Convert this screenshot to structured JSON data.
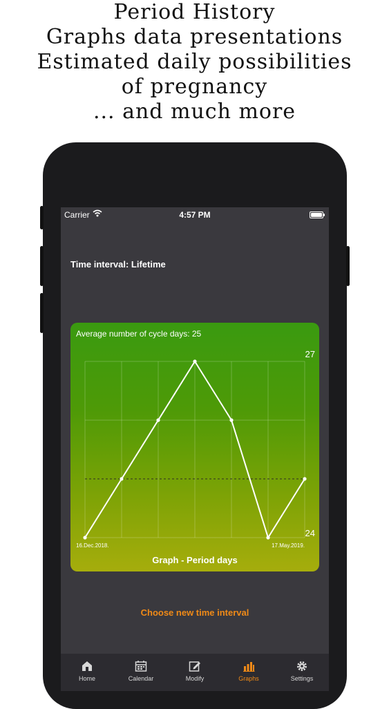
{
  "promo": {
    "lines": [
      "Period History",
      "Graphs data presentations",
      "Estimated daily possibilities",
      "of pregnancy",
      "... and much more"
    ]
  },
  "status_bar": {
    "carrier": "Carrier",
    "time": "4:57 PM"
  },
  "time_interval": "Time interval: Lifetime",
  "graph_card": {
    "average_label": "Average number of cycle days: 25",
    "title": "Graph - Period days",
    "background_colors": [
      "#3a9a10",
      "#a6ad0c"
    ]
  },
  "chart_data": {
    "type": "line",
    "title": "Graph - Period days",
    "subtitle": "Average number of cycle days: 25",
    "x_start_label": "16.Dec.2018.",
    "x_end_label": "17.May.2019.",
    "values": [
      24,
      25,
      26,
      27,
      26,
      24,
      25
    ],
    "ylim": [
      24,
      27
    ],
    "y_tick_labels": [
      "27",
      "24"
    ],
    "average_line": 25,
    "grid": true,
    "line_color": "#ffffff"
  },
  "choose_button": "Choose new time interval",
  "tabs": [
    {
      "label": "Home",
      "icon": "home-icon",
      "active": false
    },
    {
      "label": "Calendar",
      "icon": "calendar-icon",
      "active": false
    },
    {
      "label": "Modify",
      "icon": "edit-icon",
      "active": false
    },
    {
      "label": "Graphs",
      "icon": "bar-chart-icon",
      "active": true
    },
    {
      "label": "Settings",
      "icon": "gear-icon",
      "active": false
    }
  ],
  "accent_color": "#f08a17"
}
